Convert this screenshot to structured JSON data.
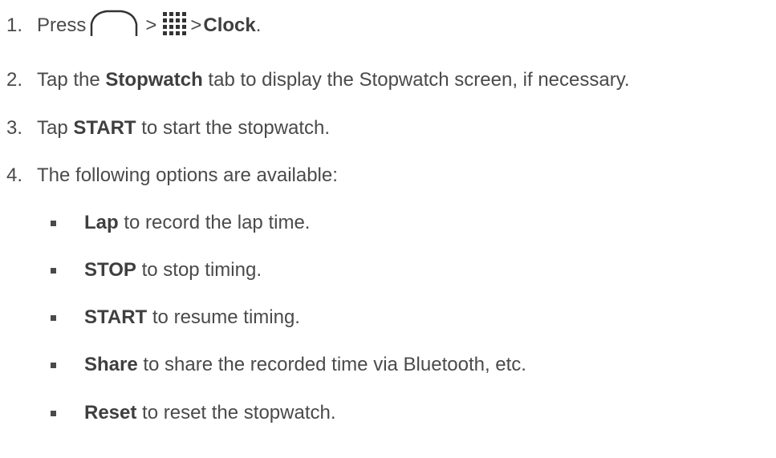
{
  "steps": [
    {
      "num": "1.",
      "prefix": "Press",
      "sep1": ">",
      "sep2": ">",
      "bold": "Clock",
      "suffix": "."
    },
    {
      "num": "2.",
      "prefix": "Tap the",
      "bold": "Stopwatch",
      "suffix": "tab to display the Stopwatch screen, if necessary."
    },
    {
      "num": "3.",
      "prefix": "Tap",
      "bold": "START",
      "suffix": "to start the stopwatch."
    },
    {
      "num": "4.",
      "text": "The following options are available:"
    }
  ],
  "options": [
    {
      "bold": "Lap",
      "text": "to record the lap time."
    },
    {
      "bold": "STOP",
      "text": "to stop timing."
    },
    {
      "bold": "START",
      "text": "to resume timing."
    },
    {
      "bold": "Share",
      "text": "to share the recorded time via Bluetooth, etc."
    },
    {
      "bold": "Reset",
      "text": "to reset the stopwatch."
    }
  ],
  "icons": {
    "home": "home-icon",
    "apps": "apps-grid-icon"
  }
}
